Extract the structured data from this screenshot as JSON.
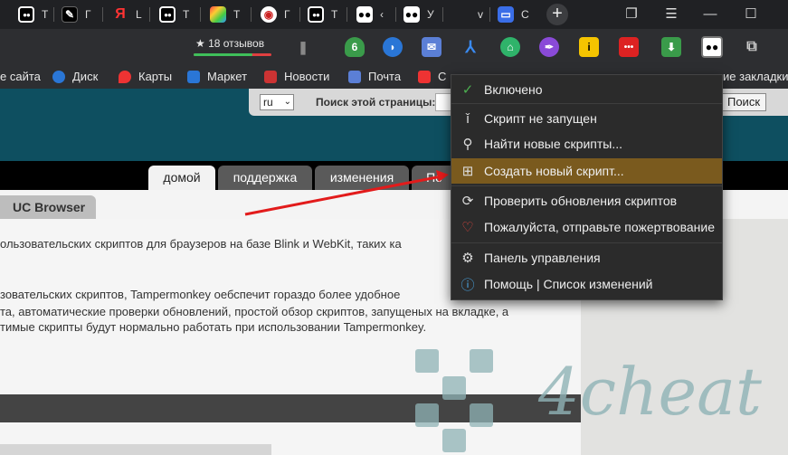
{
  "tabs": [
    {
      "icon": "tampermonkey-icon",
      "label": "T"
    },
    {
      "icon": "black-circle-icon",
      "label": "Г"
    },
    {
      "icon": "yandex-icon",
      "label": "L"
    },
    {
      "icon": "tampermonkey-icon",
      "label": "T"
    },
    {
      "icon": "colorful-app-icon",
      "label": "T"
    },
    {
      "icon": "shield-site-icon",
      "label": "Г"
    },
    {
      "icon": "tampermonkey-icon",
      "label": "T"
    },
    {
      "icon": "tampermonkey-icon",
      "label": "‹"
    },
    {
      "icon": "tampermonkey-icon",
      "label": "У"
    },
    {
      "icon": "blank-icon",
      "label": "v"
    },
    {
      "icon": "chat-icon",
      "label": "С"
    }
  ],
  "toolbar": {
    "reviews_label": "★ 18 отзывов",
    "review_positive_fraction": 0.75
  },
  "bookmarks": [
    {
      "label": "е сайта"
    },
    {
      "label": "Диск"
    },
    {
      "label": "Карты"
    },
    {
      "label": "Маркет"
    },
    {
      "label": "Новости"
    },
    {
      "label": "Почта"
    },
    {
      "label": "С"
    },
    {
      "label": "ие закладки"
    }
  ],
  "page": {
    "lang_value": "ru",
    "search_label": "Поиск этой страницы:",
    "search_button": "Поиск",
    "nav_tabs": [
      "домой",
      "поддержка",
      "изменения",
      "По"
    ],
    "sub_tab": "UC Browser",
    "text_lines": [
      "ользовательских скриптов для браузеров на базе Blink и WebKit, таких ка",
      "зовательских скриптов, Tampermonkey оебспечит гораздо более удобное",
      "та, автоматические проверки обновлений, простой обзор скриптов, запущеных на вкладке, а",
      "тимые скрипты будут нормально работать при использовании Tampermonkey."
    ],
    "watermark": "4cheat"
  },
  "menu": {
    "items": [
      {
        "icon": "check-icon",
        "label": "Включено"
      },
      {
        "icon": "script-icon",
        "label": "Скрипт не запущен"
      },
      {
        "icon": "search-icon",
        "label": "Найти новые скрипты..."
      },
      {
        "icon": "plus-square-icon",
        "label": "Создать новый скрипт..."
      },
      {
        "icon": "refresh-icon",
        "label": "Проверить обновления скриптов"
      },
      {
        "icon": "heart-icon",
        "label": "Пожалуйста, отправьте пожертвование"
      },
      {
        "icon": "gear-icon",
        "label": "Панель управления"
      },
      {
        "icon": "info-icon",
        "label": "Помощь | Список изменений"
      }
    ]
  },
  "colors": {
    "header": "#0e4f60",
    "menu_highlight": "#7a5a1e",
    "check": "#4caf50",
    "heart": "#e0463f",
    "arrow": "#e21b1b"
  }
}
